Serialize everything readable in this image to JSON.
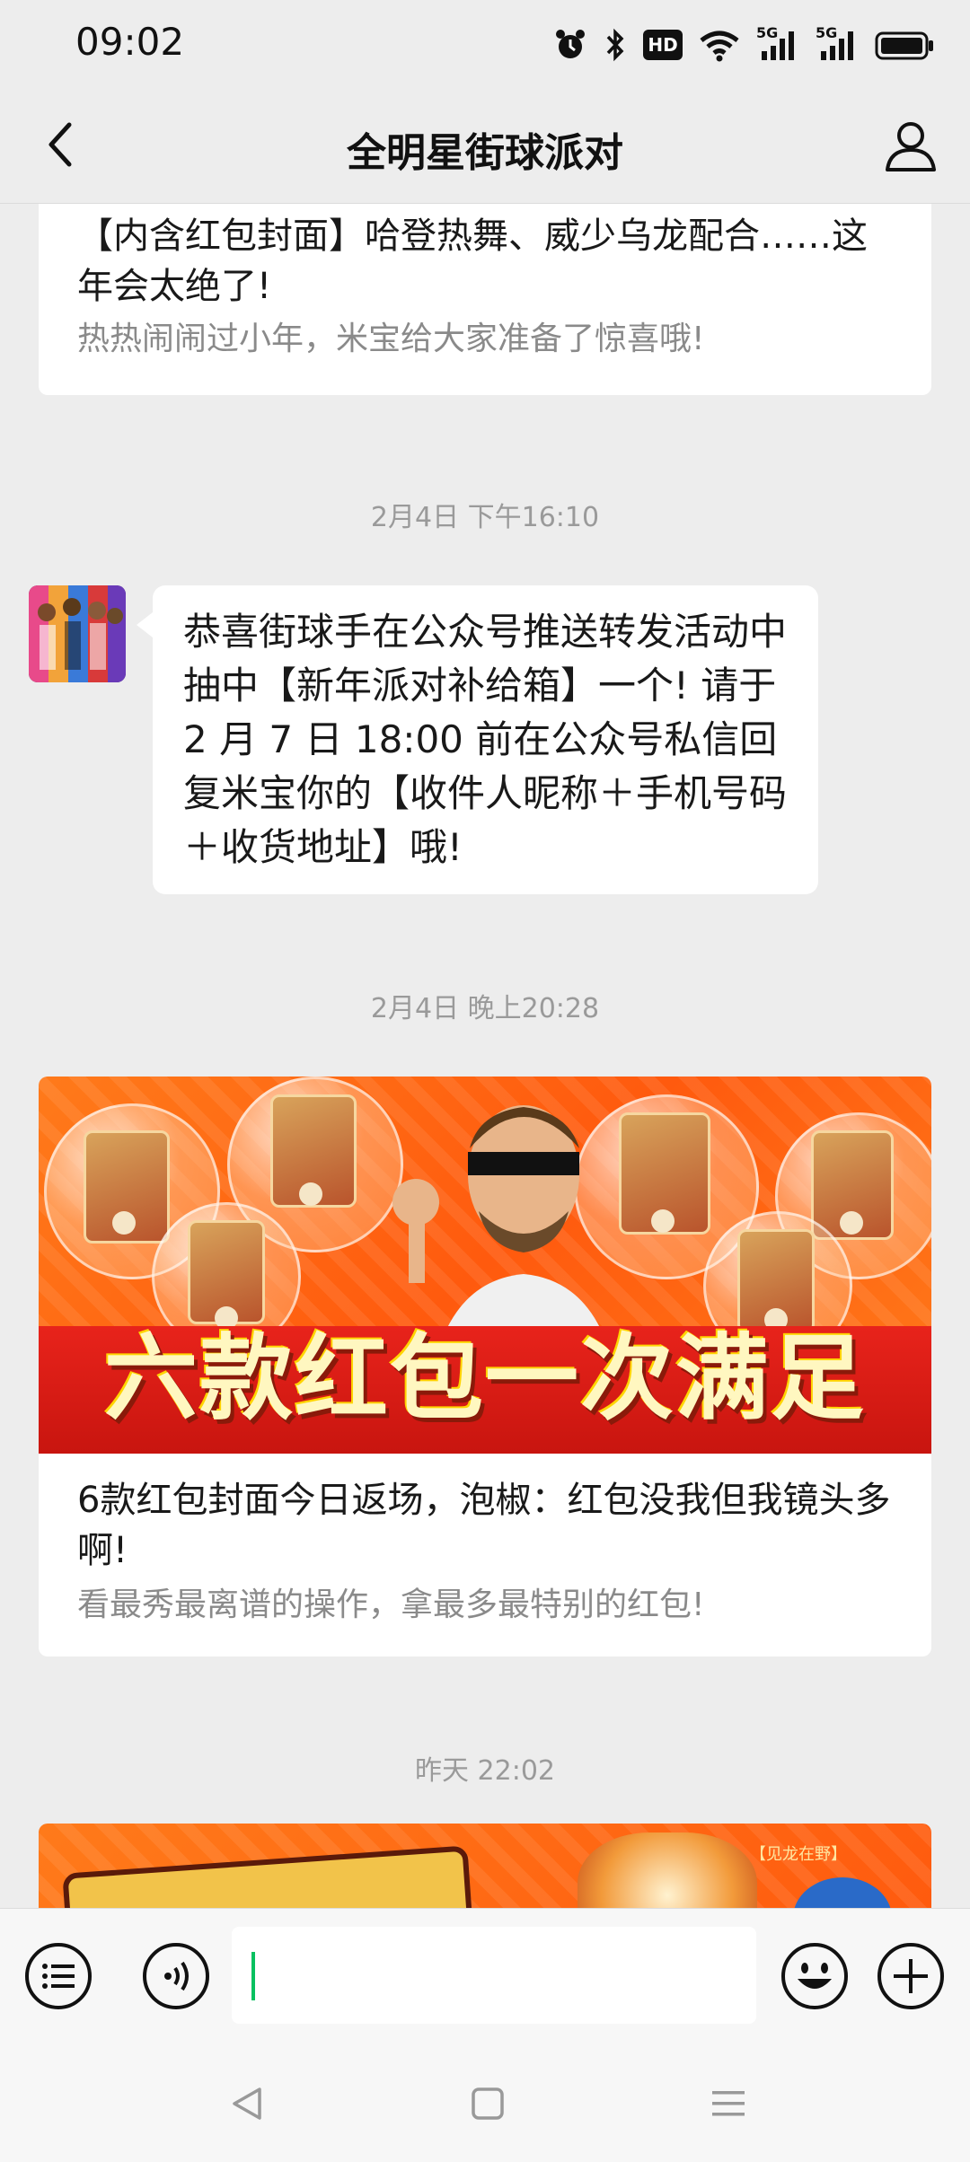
{
  "status_bar": {
    "time": "09:02",
    "hd_label": "HD",
    "signal_label_1": "5G",
    "signal_label_2": "5G"
  },
  "nav": {
    "title": "全明星街球派对"
  },
  "messages": {
    "card1": {
      "title": "【内含红包封面】哈登热舞、威少乌龙配合……这年会太绝了!",
      "desc": "热热闹闹过小年，米宝给大家准备了惊喜哦!"
    },
    "ts1": "2月4日 下午16:10",
    "text_message": "恭喜街球手在公众号推送转发活动中抽中【新年派对补给箱】一个! 请于 2 月 7 日 18:00 前在公众号私信回复米宝你的【收件人昵称＋手机号码＋收货地址】哦!",
    "ts2": "2月4日 晚上20:28",
    "card2": {
      "banner_text": "六款红包一次满足",
      "title": "6款红包封面今日返场，泡椒：红包没我但我镜头多啊!",
      "desc": "看最秀最离谱的操作，拿最多最特别的红包!"
    },
    "ts3": "昨天 22:02",
    "card3_banner_tag": "【见龙在野】"
  },
  "icons": {
    "back": "chevron-left-icon",
    "profile": "person-icon",
    "menu": "list-icon",
    "voice": "voice-icon",
    "emoji": "smiley-icon",
    "plus": "plus-icon"
  },
  "colors": {
    "background": "#ededed",
    "accent_green": "#07c160",
    "banner_orange": "#ff5a0e",
    "banner_red": "#e8231b"
  }
}
